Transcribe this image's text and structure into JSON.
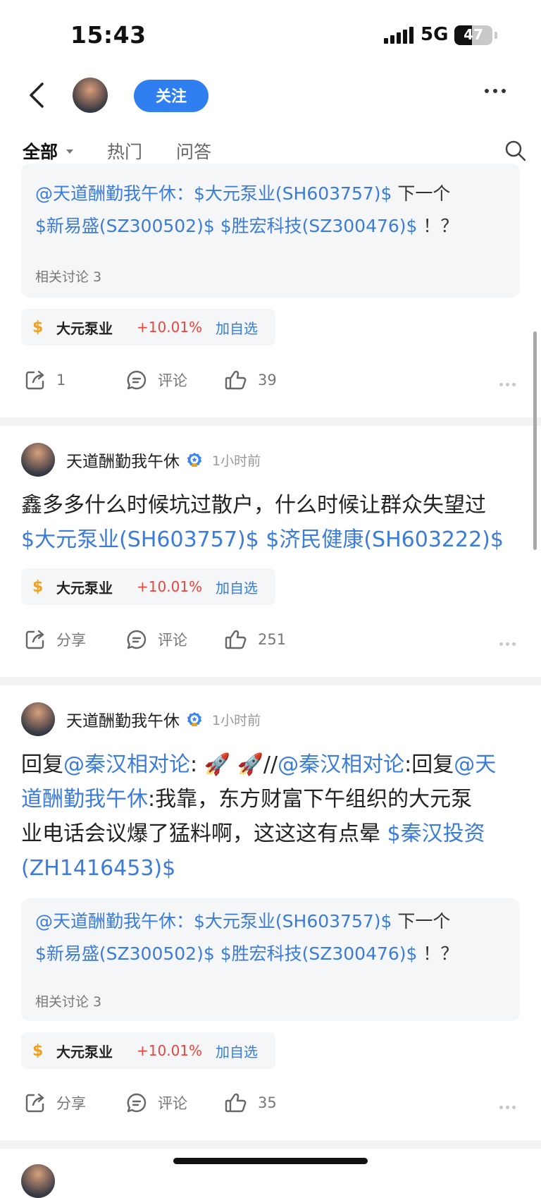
{
  "status_bar": {
    "time": "15:43",
    "network": "5G",
    "battery": "47",
    "battery_level": 0.47
  },
  "header": {
    "follow_label": "关注",
    "more_icon": "more-horizontal-icon",
    "back_icon": "chevron-left-icon"
  },
  "tabs": [
    {
      "label": "全部",
      "active": true
    },
    {
      "label": "热门",
      "active": false
    },
    {
      "label": "问答",
      "active": false
    }
  ],
  "posts": [
    {
      "quote": {
        "line1_prefix": "@天道酬勤我午休：",
        "line1_stock": "$大元泵业(SH603757)$",
        "line1_suffix": " 下一个",
        "line2_stock1": "$新易盛(SZ300502)$",
        "line2_stock2": "$胜宏科技(SZ300476)$",
        "line2_suffix": " ！？",
        "meta": "相关讨论 3"
      },
      "stock": {
        "symbol": "$",
        "name": "大元泵业",
        "change": "+10.01%",
        "add_label": "加自选"
      },
      "actions": {
        "share": "1",
        "comment": "评论",
        "like": "39"
      }
    },
    {
      "user": {
        "name": "天道酬勤我午休",
        "time": "1小时前"
      },
      "body": {
        "line1": "鑫多多什么时候坑过散户，什么时候让群众失望过",
        "stock1": "$大元泵业(SH603757)$",
        "stock2": "$济民健康(SH603222)$"
      },
      "stock": {
        "symbol": "$",
        "name": "大元泵业",
        "change": "+10.01%",
        "add_label": "加自选"
      },
      "actions": {
        "share": "分享",
        "comment": "评论",
        "like": "251"
      }
    },
    {
      "user": {
        "name": "天道酬勤我午休",
        "time": "1小时前"
      },
      "body": {
        "t1": "回复",
        "m1": "@秦汉相对论",
        "t2": ": 🚀 🚀//",
        "m2": "@秦汉相对论",
        "t3": ":回复",
        "m3a": "@天",
        "m3b": "道酬勤我午休",
        "t4": ":我靠，东方财富下午组织的大元泵",
        "t5": "业电话会议爆了猛料啊，这这这有点晕 ",
        "s1a": "$秦汉投资",
        "s1b": "(ZH1416453)$"
      },
      "quote": {
        "line1_prefix": "@天道酬勤我午休：",
        "line1_stock": "$大元泵业(SH603757)$",
        "line1_suffix": " 下一个",
        "line2_stock1": "$新易盛(SZ300502)$",
        "line2_stock2": "$胜宏科技(SZ300476)$",
        "line2_suffix": " ！？",
        "meta": "相关讨论 3"
      },
      "stock": {
        "symbol": "$",
        "name": "大元泵业",
        "change": "+10.01%",
        "add_label": "加自选"
      },
      "actions": {
        "share": "分享",
        "comment": "评论",
        "like": "35"
      }
    }
  ],
  "colors": {
    "accent": "#2f7ff0",
    "link": "#3b7cd9",
    "up": "#e8463c",
    "dollar": "#f0a020"
  }
}
